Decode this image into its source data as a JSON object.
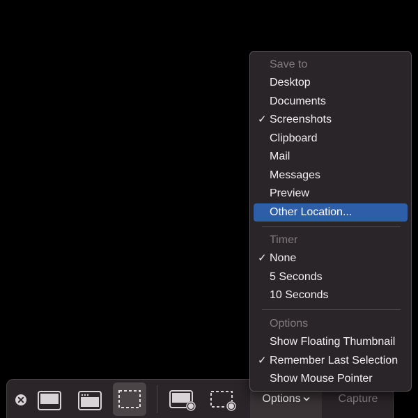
{
  "toolbar": {
    "options_label": "Options",
    "capture_label": "Capture",
    "icons": {
      "close": "close-circle-icon",
      "capture_screen": "capture-entire-screen-icon",
      "capture_window": "capture-window-icon",
      "capture_selection": "capture-selection-icon",
      "record_screen": "record-entire-screen-icon",
      "record_selection": "record-selection-icon",
      "chevron": "chevron-down-icon"
    }
  },
  "menu": {
    "save_to": {
      "header": "Save to",
      "items": [
        {
          "label": "Desktop",
          "checked": false
        },
        {
          "label": "Documents",
          "checked": false
        },
        {
          "label": "Screenshots",
          "checked": true
        },
        {
          "label": "Clipboard",
          "checked": false
        },
        {
          "label": "Mail",
          "checked": false
        },
        {
          "label": "Messages",
          "checked": false
        },
        {
          "label": "Preview",
          "checked": false
        },
        {
          "label": "Other Location...",
          "checked": false,
          "highlighted": true
        }
      ]
    },
    "timer": {
      "header": "Timer",
      "items": [
        {
          "label": "None",
          "checked": true
        },
        {
          "label": "5 Seconds",
          "checked": false
        },
        {
          "label": "10 Seconds",
          "checked": false
        }
      ]
    },
    "options": {
      "header": "Options",
      "items": [
        {
          "label": "Show Floating Thumbnail",
          "checked": false
        },
        {
          "label": "Remember Last Selection",
          "checked": true
        },
        {
          "label": "Show Mouse Pointer",
          "checked": false
        }
      ]
    },
    "check_glyph": "✓"
  },
  "colors": {
    "highlight": "#2f5ea8",
    "menu_bg": "#2a2529",
    "toolbar_bg": "#2b2529"
  }
}
